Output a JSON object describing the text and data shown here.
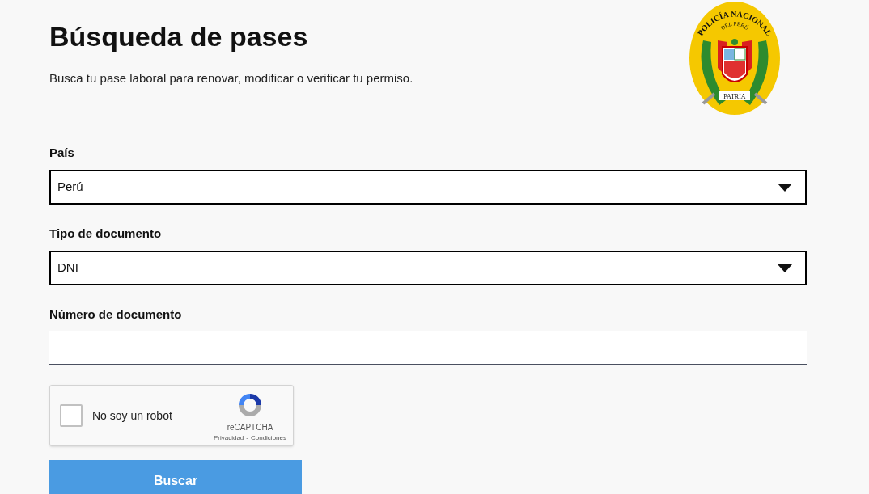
{
  "header": {
    "title": "Búsqueda de pases",
    "subtitle": "Busca tu pase laboral para renovar, modificar o verificar tu permiso.",
    "emblem": {
      "top_text": "POLICÍA NACIONAL",
      "middle_text": "DEL PERÚ",
      "bottom_text": "PATRIA"
    }
  },
  "fields": [
    {
      "kind": "select",
      "label": "País",
      "value": "Perú"
    },
    {
      "kind": "select",
      "label": "Tipo de documento",
      "value": "DNI"
    },
    {
      "kind": "text",
      "label": "Número de documento"
    }
  ],
  "captcha": {
    "label": "No soy un robot",
    "checked": false,
    "brand": "reCAPTCHA",
    "links": [
      "Privacidad",
      "Condiciones"
    ],
    "separator": "-"
  },
  "submit": {
    "label": "Buscar"
  }
}
